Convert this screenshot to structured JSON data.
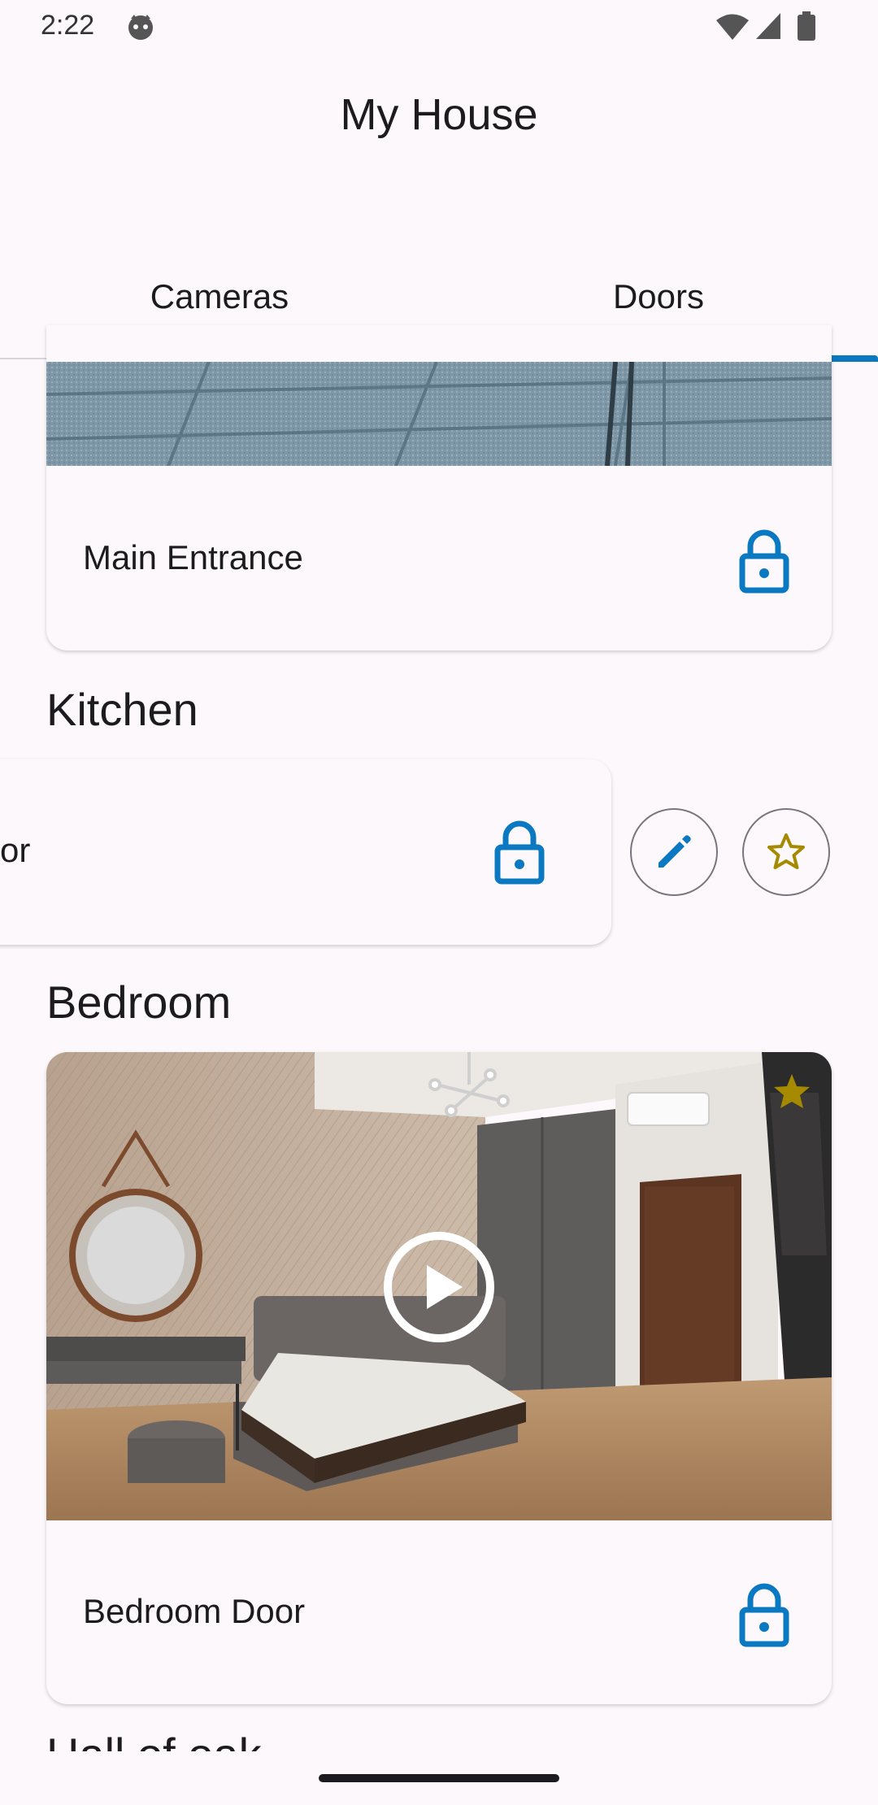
{
  "status_bar": {
    "time": "2:22"
  },
  "app_bar": {
    "title": "My House"
  },
  "tabs": [
    {
      "label": "Cameras",
      "selected": false
    },
    {
      "label": "Doors",
      "selected": true
    }
  ],
  "doors": [
    {
      "name": "Main Entrance",
      "lock_icon": "lock-icon"
    },
    {
      "section": "Kitchen",
      "name_visible": "or",
      "lock_icon": "lock-icon",
      "actions": [
        "edit-icon",
        "star-outline-icon"
      ]
    },
    {
      "section": "Bedroom",
      "name": "Bedroom Door",
      "lock_icon": "lock-icon",
      "favorite": true
    }
  ],
  "next_section_partial": "Hall of oak",
  "colors": {
    "accent": "#0a79c1",
    "star": "#a58a00",
    "background": "#fcf8fb"
  }
}
